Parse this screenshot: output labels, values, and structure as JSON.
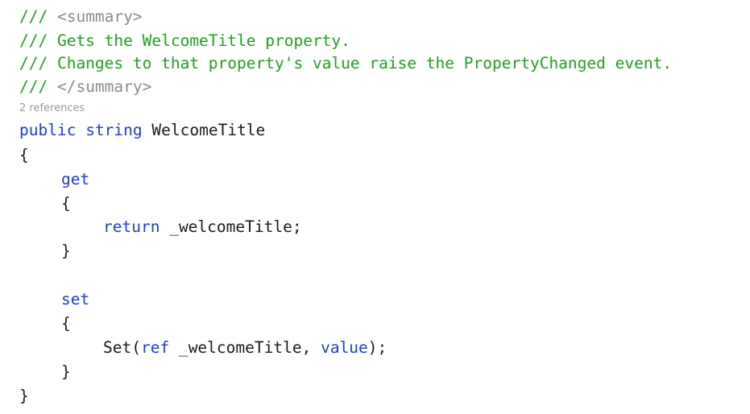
{
  "colors": {
    "comment": "#21a021",
    "xml_tag": "#8c8c8c",
    "keyword": "#1d3fd8",
    "text": "#1a1a1a",
    "codelens": "#999999",
    "background": "#ffffff"
  },
  "code": {
    "line1": {
      "prefix": "/// ",
      "tag": "<summary>"
    },
    "line2": {
      "text": "/// Gets the WelcomeTitle property."
    },
    "line3": {
      "text": "/// Changes to that property's value raise the PropertyChanged event."
    },
    "line4": {
      "prefix": "/// ",
      "tag": "</summary>"
    },
    "codelens": "2 references",
    "line5": {
      "kw1": "public",
      "kw2": "string",
      "name": "WelcomeTitle"
    },
    "line6": {
      "brace": "{"
    },
    "line7": {
      "kw": "get"
    },
    "line8": {
      "brace": "{"
    },
    "line9": {
      "kw": "return",
      "rest": "_welcomeTitle;"
    },
    "line10": {
      "brace": "}"
    },
    "line11": {
      "kw": "set"
    },
    "line12": {
      "brace": "{"
    },
    "line13": {
      "call": "Set(",
      "kw_ref": "ref",
      "arg": "_welcomeTitle,",
      "kw_value": "value",
      "end": ");"
    },
    "line14": {
      "brace": "}"
    },
    "line15": {
      "brace": "}"
    }
  }
}
